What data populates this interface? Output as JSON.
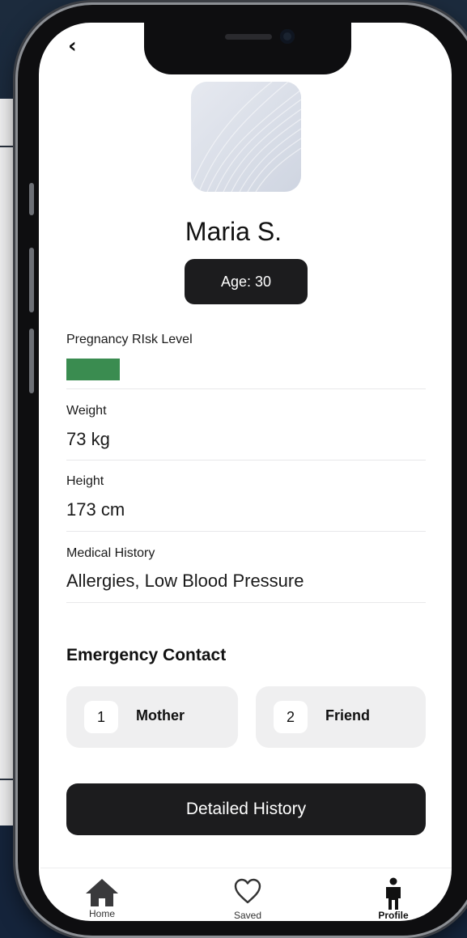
{
  "header": {
    "back_glyph": "‹"
  },
  "profile": {
    "name": "Maria S.",
    "age_label": "Age: 30"
  },
  "fields": {
    "risk": {
      "label": "Pregnancy RIsk Level",
      "level_color": "#3a8c50"
    },
    "weight": {
      "label": "Weight",
      "value": "73 kg"
    },
    "height": {
      "label": "Height",
      "value": "173 cm"
    },
    "history": {
      "label": "Medical History",
      "value": "Allergies, Low Blood Pressure"
    }
  },
  "emergency": {
    "title": "Emergency Contact",
    "contacts": [
      {
        "num": "1",
        "name": "Mother"
      },
      {
        "num": "2",
        "name": "Friend"
      }
    ]
  },
  "actions": {
    "detailed_history": "Detailed History"
  },
  "tabs": [
    {
      "label": "Home",
      "icon": "home-icon"
    },
    {
      "label": "Saved",
      "icon": "heart-icon"
    },
    {
      "label": "Profile",
      "icon": "person-icon"
    }
  ]
}
